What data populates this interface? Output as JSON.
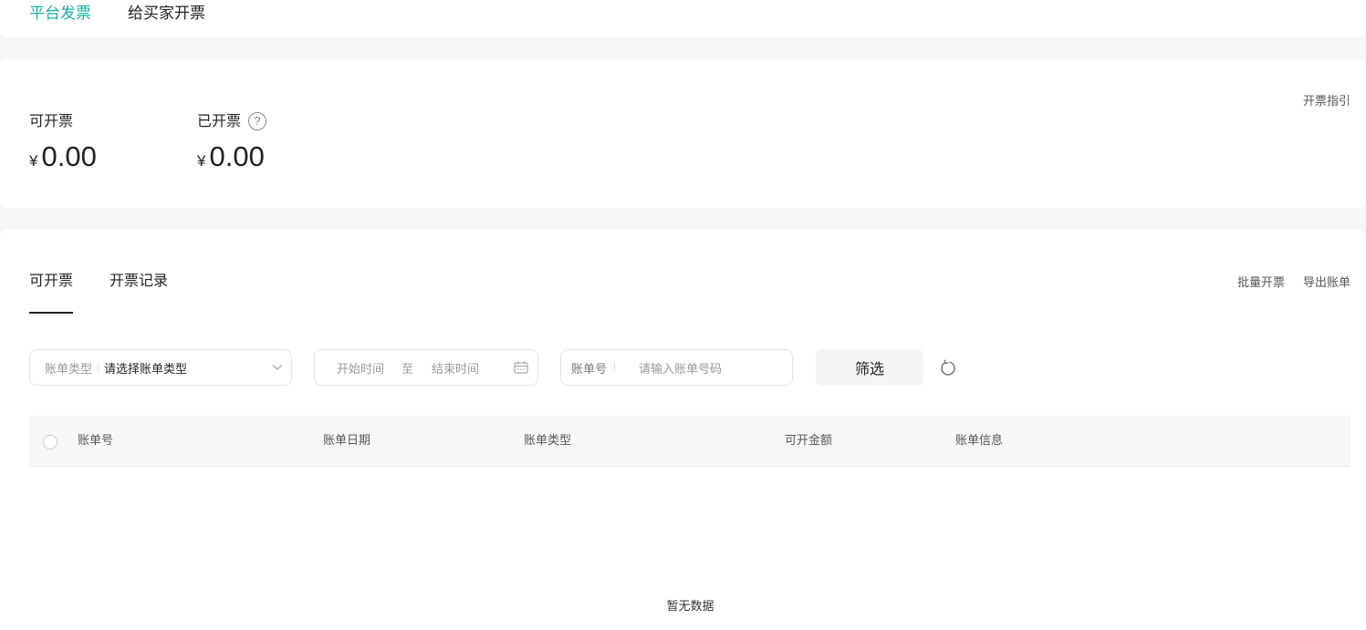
{
  "top_tabs": [
    {
      "label": "平台发票",
      "active": true
    },
    {
      "label": "给买家开票",
      "active": false
    }
  ],
  "summary": {
    "guide_link": "开票指引",
    "available": {
      "label": "可开票",
      "currency": "¥",
      "amount": "0.00"
    },
    "issued": {
      "label": "已开票",
      "currency": "¥",
      "amount": "0.00",
      "help_glyph": "?"
    }
  },
  "sub_tabs": [
    {
      "label": "可开票",
      "active": true
    },
    {
      "label": "开票记录",
      "active": false
    }
  ],
  "actions": {
    "batch": "批量开票",
    "export": "导出账单"
  },
  "filters": {
    "bill_type": {
      "label": "账单类型",
      "value": "请选择账单类型"
    },
    "date_range": {
      "start_placeholder": "开始时间",
      "separator": "至",
      "end_placeholder": "结束时间"
    },
    "bill_no": {
      "label": "账单号",
      "placeholder": "请输入账单号码"
    },
    "submit": "筛选"
  },
  "table": {
    "columns": [
      "账单号",
      "账单日期",
      "账单类型",
      "可开金额",
      "账单信息"
    ],
    "empty_text": "暂无数据"
  },
  "colors": {
    "accent": "#1aae9f",
    "text": "#222222",
    "muted": "#999999"
  }
}
